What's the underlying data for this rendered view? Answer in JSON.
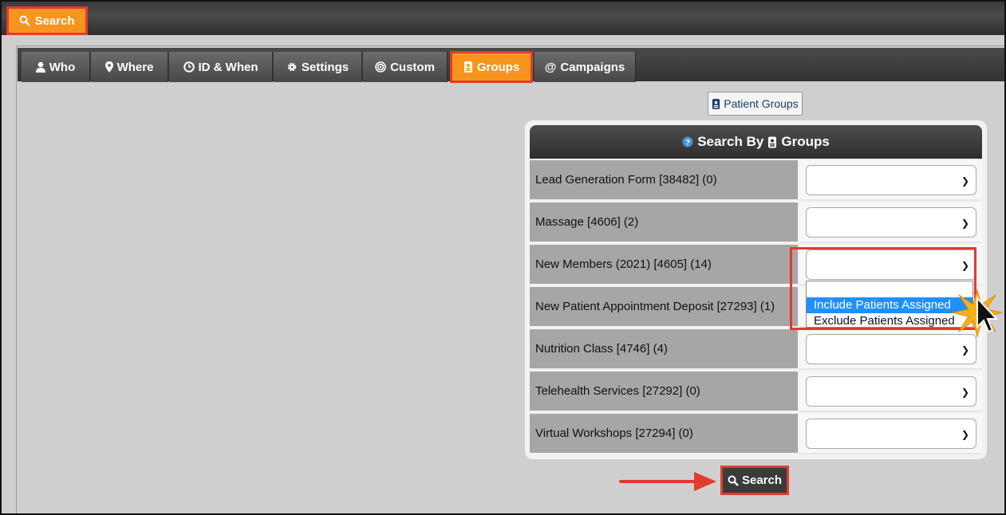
{
  "header": {
    "search_label": "Search"
  },
  "tabs": [
    {
      "label": "Who",
      "icon": "user-icon"
    },
    {
      "label": "Where",
      "icon": "map-pin-icon"
    },
    {
      "label": "ID & When",
      "icon": "clock-icon"
    },
    {
      "label": "Settings",
      "icon": "gear-icon"
    },
    {
      "label": "Custom",
      "icon": "target-icon"
    },
    {
      "label": "Groups",
      "icon": "patient-group-icon",
      "active": true
    },
    {
      "label": "Campaigns",
      "icon": "at-icon"
    }
  ],
  "patient_groups_button": "Patient Groups",
  "panel": {
    "title": "Search By",
    "title_suffix": "Groups",
    "rows": [
      {
        "label": "Lead Generation Form [38482] (0)",
        "value": ""
      },
      {
        "label": "Massage [4606] (2)",
        "value": ""
      },
      {
        "label": "New Members (2021) [4605] (14)",
        "value": ""
      },
      {
        "label": "New Patient Appointment Deposit [27293] (1)",
        "value": ""
      },
      {
        "label": "Nutrition Class [4746] (4)",
        "value": ""
      },
      {
        "label": "Telehealth Services [27292] (0)",
        "value": ""
      },
      {
        "label": "Virtual Workshops [27294] (0)",
        "value": ""
      }
    ]
  },
  "dropdown": {
    "options": [
      "",
      "Include Patients Assigned",
      "Exclude Patients Assigned"
    ],
    "highlighted": "Include Patients Assigned"
  },
  "footer": {
    "search_label": "Search"
  },
  "colors": {
    "accent": "#f7941d",
    "highlight_border": "#e23b2e",
    "selected_option": "#1e90ff"
  }
}
